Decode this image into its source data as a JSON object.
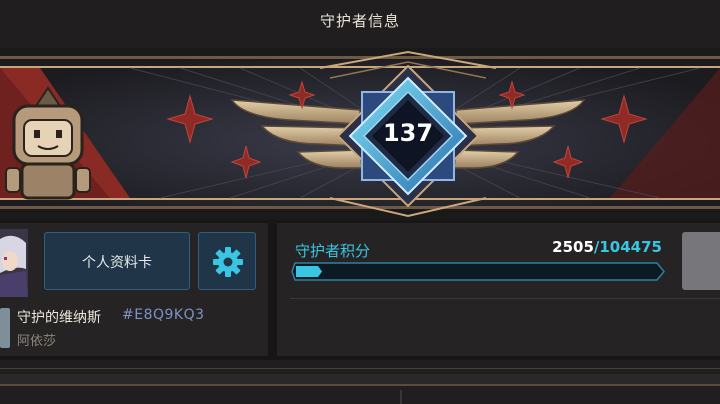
{
  "header": {
    "title": "守护者信息"
  },
  "banner": {
    "level": "137"
  },
  "profile": {
    "card_button_label": "个人资料卡",
    "player_name": "守护的维纳斯",
    "player_tag": "#E8Q9KQ3",
    "player_alias": "阿依莎"
  },
  "score": {
    "label": "守护者积分",
    "current": "2505",
    "separator": "/",
    "max": "104475",
    "progress_fraction": 0.024
  },
  "icons": {
    "settings": "gear-icon",
    "mascot": "knight-mascot-icon",
    "emblem": "winged-level-emblem"
  },
  "colors": {
    "accent_cyan": "#3ac6e3",
    "button_bg": "#203648",
    "gold_trim": "#c9a77a",
    "banner_red": "#8a2a25"
  }
}
